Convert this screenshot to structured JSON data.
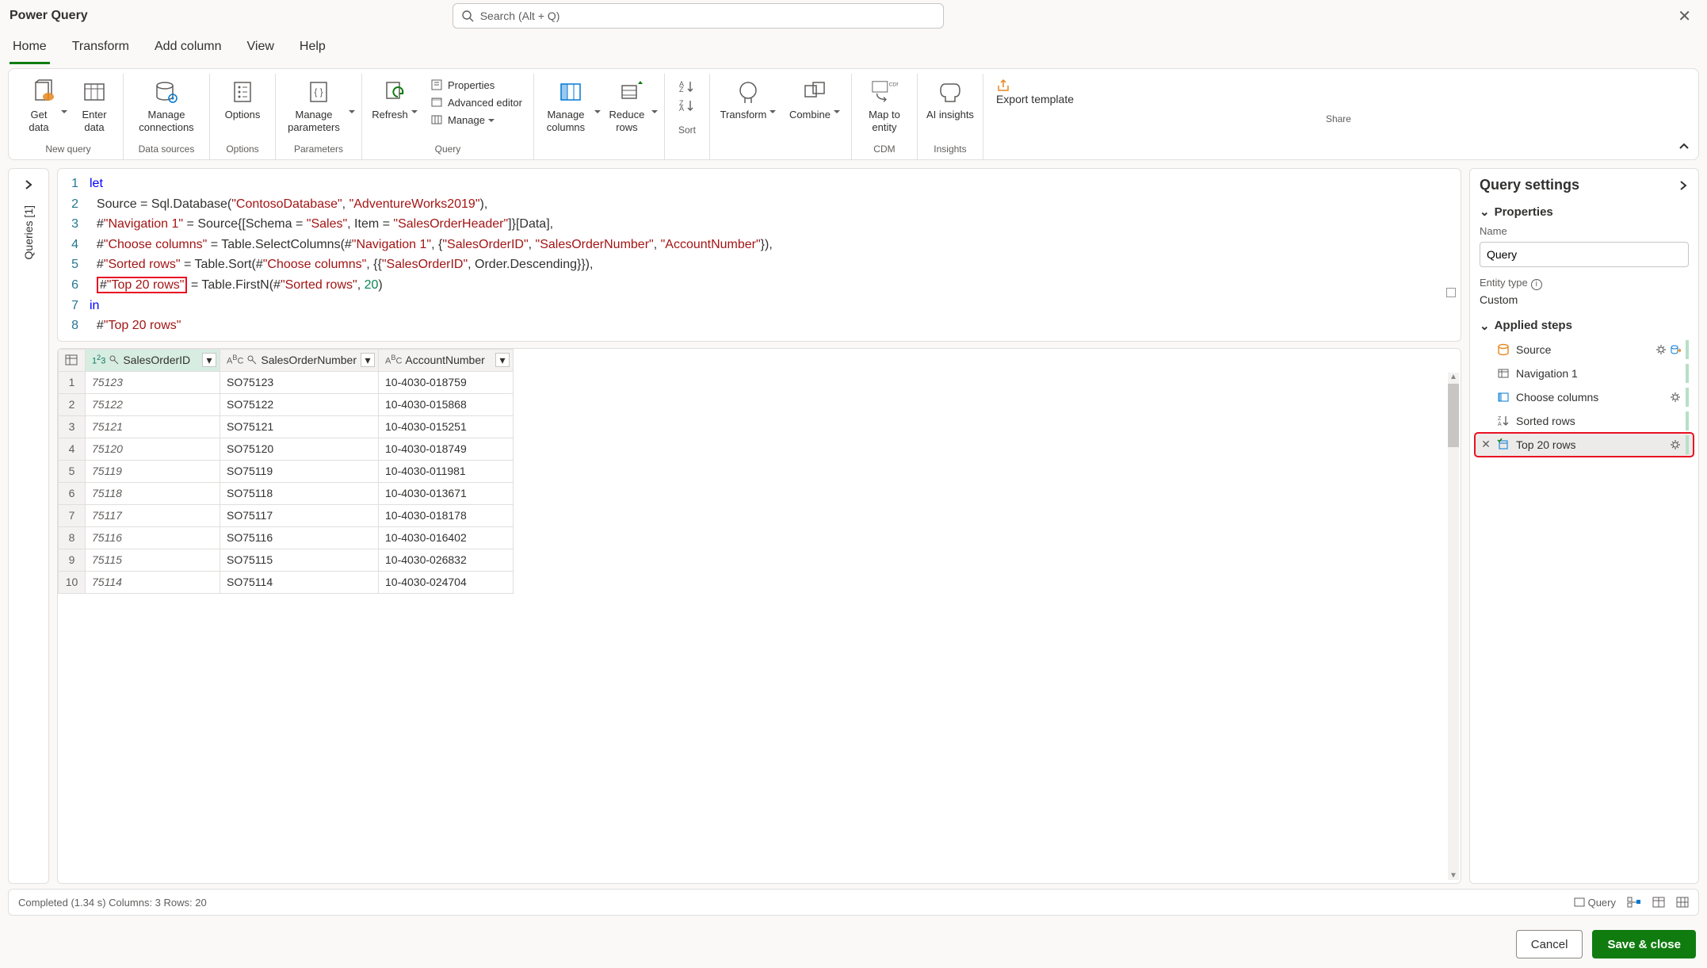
{
  "titlebar": {
    "title": "Power Query",
    "search_placeholder": "Search (Alt + Q)"
  },
  "tabs": {
    "home": "Home",
    "transform": "Transform",
    "addcol": "Add column",
    "view": "View",
    "help": "Help"
  },
  "ribbon": {
    "get_data": "Get data",
    "enter_data": "Enter data",
    "manage_conn": "Manage connections",
    "options": "Options",
    "manage_params": "Manage parameters",
    "refresh": "Refresh",
    "properties": "Properties",
    "advanced": "Advanced editor",
    "manage": "Manage",
    "manage_cols": "Manage columns",
    "reduce_rows": "Reduce rows",
    "sort_label": "",
    "transform": "Transform",
    "combine": "Combine",
    "map_entity": "Map to entity",
    "ai": "AI insights",
    "export_tpl": "Export template",
    "group_newquery": "New query",
    "group_datasources": "Data sources",
    "group_options": "Options",
    "group_parameters": "Parameters",
    "group_query": "Query",
    "group_sort": "Sort",
    "group_cdm": "CDM",
    "group_insights": "Insights",
    "group_share": "Share"
  },
  "left_rail": {
    "label": "Queries [1]"
  },
  "editor": {
    "lines": [
      {
        "n": "1",
        "pre": "let",
        "cls": "tok-kw"
      },
      {
        "n": "2",
        "raw": "  Source = Sql.Database(\"ContosoDatabase\", \"AdventureWorks2019\"),"
      },
      {
        "n": "3",
        "raw": "  #\"Navigation 1\" = Source{[Schema = \"Sales\", Item = \"SalesOrderHeader\"]}[Data],"
      },
      {
        "n": "4",
        "raw": "  #\"Choose columns\" = Table.SelectColumns(#\"Navigation 1\", {\"SalesOrderID\", \"SalesOrderNumber\", \"AccountNumber\"}),"
      },
      {
        "n": "5",
        "raw": "  #\"Sorted rows\" = Table.Sort(#\"Choose columns\", {{\"SalesOrderID\", Order.Descending}}),"
      },
      {
        "n": "6",
        "raw": "  #\"Top 20 rows\" = Table.FirstN(#\"Sorted rows\", 20)"
      },
      {
        "n": "7",
        "pre": "in",
        "cls": "tok-kw"
      },
      {
        "n": "8",
        "raw": "  #\"Top 20 rows\""
      }
    ],
    "highlighted_step": "#\"Top 20 rows\""
  },
  "table": {
    "columns": [
      "SalesOrderID",
      "SalesOrderNumber",
      "AccountNumber"
    ],
    "rows": [
      {
        "n": 1,
        "id": "75123",
        "so": "SO75123",
        "ac": "10-4030-018759"
      },
      {
        "n": 2,
        "id": "75122",
        "so": "SO75122",
        "ac": "10-4030-015868"
      },
      {
        "n": 3,
        "id": "75121",
        "so": "SO75121",
        "ac": "10-4030-015251"
      },
      {
        "n": 4,
        "id": "75120",
        "so": "SO75120",
        "ac": "10-4030-018749"
      },
      {
        "n": 5,
        "id": "75119",
        "so": "SO75119",
        "ac": "10-4030-011981"
      },
      {
        "n": 6,
        "id": "75118",
        "so": "SO75118",
        "ac": "10-4030-013671"
      },
      {
        "n": 7,
        "id": "75117",
        "so": "SO75117",
        "ac": "10-4030-018178"
      },
      {
        "n": 8,
        "id": "75116",
        "so": "SO75116",
        "ac": "10-4030-016402"
      },
      {
        "n": 9,
        "id": "75115",
        "so": "SO75115",
        "ac": "10-4030-026832"
      },
      {
        "n": 10,
        "id": "75114",
        "so": "SO75114",
        "ac": "10-4030-024704"
      }
    ]
  },
  "settings": {
    "title": "Query settings",
    "properties": "Properties",
    "name_label": "Name",
    "name_value": "Query",
    "entity_type_label": "Entity type",
    "entity_type_value": "Custom",
    "applied_steps": "Applied steps",
    "steps": [
      {
        "label": "Source",
        "gear": true,
        "extra": true
      },
      {
        "label": "Navigation 1"
      },
      {
        "label": "Choose columns",
        "gear": true
      },
      {
        "label": "Sorted rows"
      },
      {
        "label": "Top 20 rows",
        "gear": true,
        "selected": true,
        "highlighted": true,
        "x": true
      }
    ]
  },
  "status": {
    "left": "Completed (1.34 s)    Columns: 3   Rows: 20",
    "query": "Query"
  },
  "footer": {
    "cancel": "Cancel",
    "save": "Save & close"
  }
}
